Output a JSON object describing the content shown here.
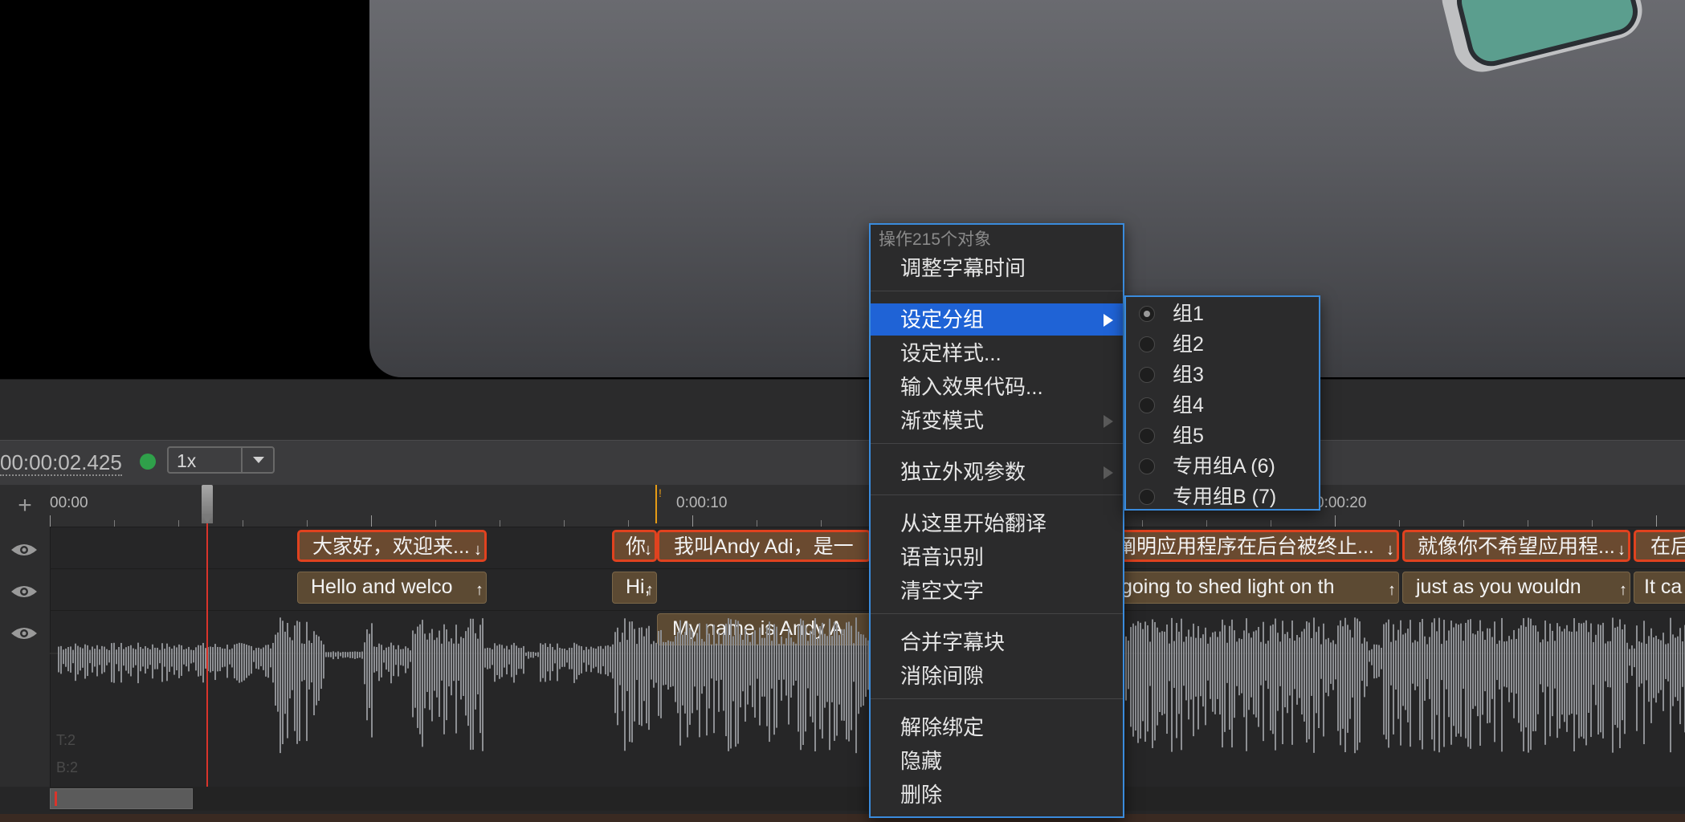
{
  "toolbar": {
    "current_time": "00:00:02.425",
    "speed": "1x"
  },
  "ruler": {
    "labels": [
      "00:00",
      "0:00:10",
      "0:00:20"
    ]
  },
  "marker_label": "!",
  "subtitles": {
    "chinese": [
      "大家好，欢迎来...",
      "你",
      "我叫Andy Adi，是一",
      "阐明应用程序在后台被终止...",
      "就像你不希望应用程...",
      "在后"
    ],
    "english": [
      "Hello and welco",
      "Hi,",
      "going to shed light on th",
      "just as you wouldn",
      "It ca"
    ],
    "third_track": [
      "My name is Andy A"
    ]
  },
  "track_labels": {
    "t": "T:2",
    "b": "B:2"
  },
  "context_menu": {
    "header": "操作215个对象",
    "items": {
      "adjust_timing": "调整字幕时间",
      "set_group": "设定分组",
      "set_style": "设定样式...",
      "input_effect_code": "输入效果代码...",
      "gradient_mode": "渐变模式",
      "appearance_params": "独立外观参数",
      "translate_from_here": "从这里开始翻译",
      "speech_recognition": "语音识别",
      "clear_text": "清空文字",
      "merge_blocks": "合并字幕块",
      "remove_gaps": "消除间隙",
      "unbind": "解除绑定",
      "hide": "隐藏",
      "delete": "删除"
    }
  },
  "group_submenu": {
    "items": [
      "组1",
      "组2",
      "组3",
      "组4",
      "组5",
      "专用组A (6)",
      "专用组B (7)"
    ],
    "selected_index": 0
  },
  "colors": {
    "accent": "#1f63d6",
    "menu_border": "#3a8bdc",
    "playhead": "#d9342b",
    "subtitle_border": "#e0421f",
    "status_dot": "#2fa04a"
  }
}
